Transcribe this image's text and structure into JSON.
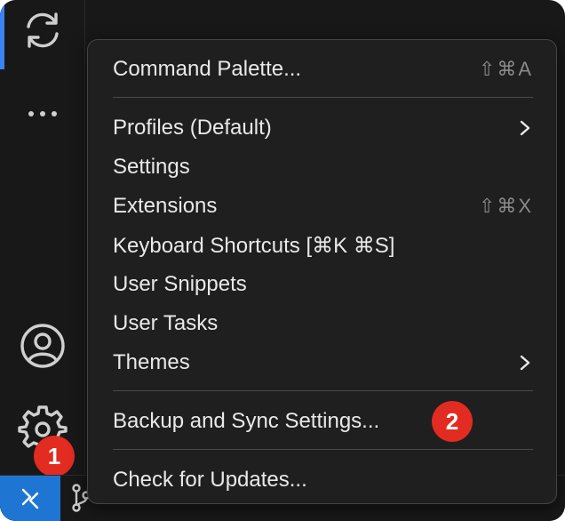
{
  "menu": {
    "items": [
      {
        "label": "Command Palette...",
        "shortcut": "⇧⌘A"
      },
      {
        "label": "Profiles (Default)",
        "submenu": true
      },
      {
        "label": "Settings"
      },
      {
        "label": "Extensions",
        "shortcut": "⇧⌘X"
      },
      {
        "label": "Keyboard Shortcuts [⌘K ⌘S]"
      },
      {
        "label": "User Snippets"
      },
      {
        "label": "User Tasks"
      },
      {
        "label": "Themes",
        "submenu": true
      },
      {
        "label": "Backup and Sync Settings..."
      },
      {
        "label": "Check for Updates..."
      }
    ]
  },
  "badges": {
    "one": "1",
    "two": "2"
  },
  "colors": {
    "background": "#181818",
    "menu_background": "#1f1f1f",
    "menu_text": "#e9e9e9",
    "shortcut_text": "#8a8a8a",
    "badge": "#e22b21",
    "remote_button": "#1f76d2",
    "active_indicator": "#3b82f6"
  },
  "icons": {
    "activity_bar": [
      "sync-icon",
      "more-icon",
      "account-icon",
      "gear-icon"
    ],
    "status_bar": [
      "remote-icon",
      "source-control-branch-icon"
    ],
    "submenu": "chevron-right-icon"
  }
}
